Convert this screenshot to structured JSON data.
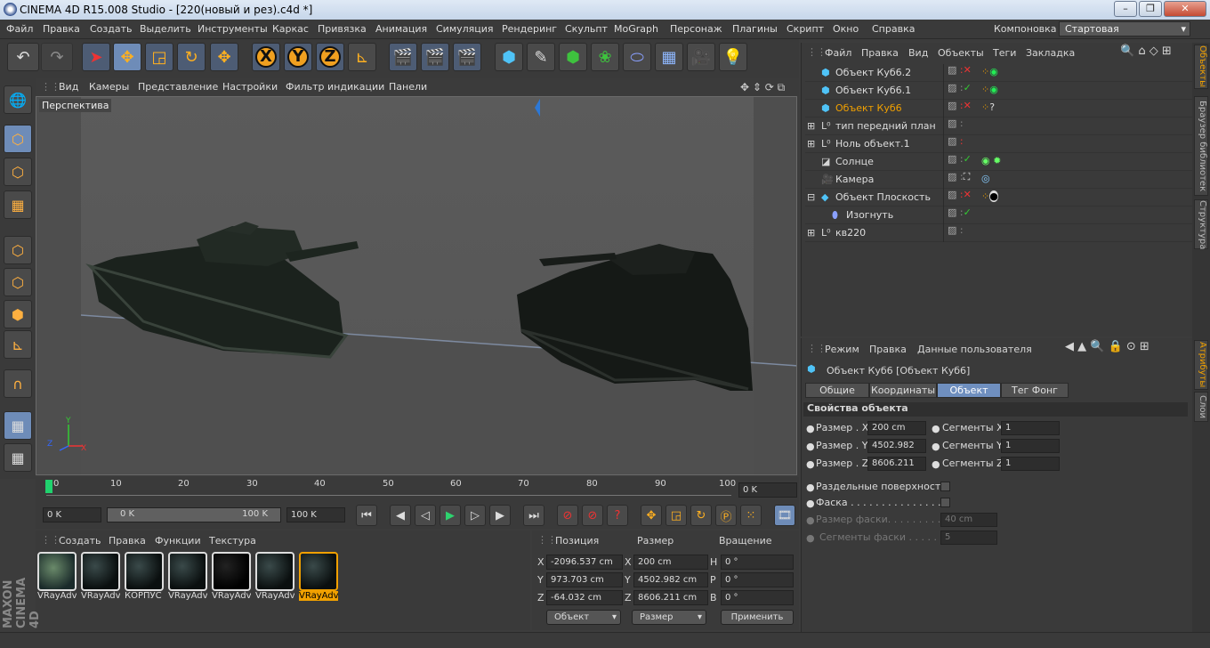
{
  "window": {
    "title": "CINEMA 4D R15.008 Studio - [220(новый  и рез).c4d *]"
  },
  "menu": [
    "Файл",
    "Правка",
    "Создать",
    "Выделить",
    "Инструменты",
    "Каркас",
    "Привязка",
    "Анимация",
    "Симуляция",
    "Рендеринг",
    "Скульпт",
    "MoGraph",
    "Персонаж",
    "Плагины",
    "Скрипт",
    "Окно",
    "Справка"
  ],
  "layout": {
    "label": "Компоновка",
    "value": "Стартовая"
  },
  "toolbar": {
    "x": "X",
    "y": "Y",
    "z": "Z"
  },
  "viewport": {
    "menu": [
      "Вид",
      "Камеры",
      "Представление",
      "Настройки",
      "Фильтр индикации",
      "Панели"
    ],
    "label": "Перспектива"
  },
  "timeline": {
    "ticks": [
      "0",
      "10",
      "20",
      "30",
      "40",
      "50",
      "60",
      "70",
      "80",
      "90",
      "100"
    ],
    "end_field": "0 K"
  },
  "playbar": {
    "start": "0 K",
    "range_start": "0 K",
    "range_end": "100 K",
    "end": "100 K"
  },
  "materials": {
    "menu": [
      "Создать",
      "Правка",
      "Функции",
      "Текстура"
    ],
    "items": [
      {
        "label": "VRayAdv"
      },
      {
        "label": "VRayAdv"
      },
      {
        "label": "КОРПУС"
      },
      {
        "label": "VRayAdv"
      },
      {
        "label": "VRayAdv"
      },
      {
        "label": "VRayAdv"
      },
      {
        "label": "VRayAdv"
      }
    ]
  },
  "coords": {
    "headers": {
      "position": "Позиция",
      "size": "Размер",
      "rotation": "Вращение"
    },
    "rows": [
      {
        "axis": "X",
        "pos": "-2096.537 cm",
        "saxis": "X",
        "size": "200 cm",
        "raxis": "H",
        "rot": "0 °"
      },
      {
        "axis": "Y",
        "pos": "973.703 cm",
        "saxis": "Y",
        "size": "4502.982 cm",
        "raxis": "P",
        "rot": "0 °"
      },
      {
        "axis": "Z",
        "pos": "-64.032 cm",
        "saxis": "Z",
        "size": "8606.211 cm",
        "raxis": "B",
        "rot": "0 °"
      }
    ],
    "mode": "Объект",
    "size_mode": "Размер",
    "apply": "Применить"
  },
  "objects": {
    "menu": [
      "Файл",
      "Правка",
      "Вид",
      "Объекты",
      "Теги",
      "Закладка"
    ],
    "items": [
      {
        "name": "Объект Куб6.2",
        "selected": false
      },
      {
        "name": "Объект Куб6.1",
        "selected": false
      },
      {
        "name": "Объект Куб6",
        "selected": true
      },
      {
        "name": "тип   передний  план",
        "selected": false
      },
      {
        "name": "Ноль объект.1",
        "selected": false
      },
      {
        "name": "Солнце",
        "selected": false
      },
      {
        "name": "Камера",
        "selected": false
      },
      {
        "name": "Объект Плоскость",
        "selected": false
      },
      {
        "name": "Изогнуть",
        "selected": false
      },
      {
        "name": "кв220",
        "selected": false
      }
    ]
  },
  "attributes": {
    "menu": [
      "Режим",
      "Правка",
      "Данные пользователя"
    ],
    "title": "Объект Куб6 [Объект Куб6]",
    "tabs": [
      "Общие",
      "Координаты",
      "Объект",
      "Тег Фонг"
    ],
    "selected_tab": "Объект",
    "section": "Свойства объекта",
    "size_x_label": "Размер . X",
    "size_x": "200 cm",
    "size_y_label": "Размер . Y",
    "size_y": "4502.982",
    "size_z_label": "Размер . Z",
    "size_z": "8606.211",
    "seg_x_label": "Сегменты X",
    "seg_x": "1",
    "seg_y_label": "Сегменты Y",
    "seg_y": "1",
    "seg_z_label": "Сегменты Z",
    "seg_z": "1",
    "separate_label": "Раздельные поверхности",
    "fillet_label": "Фаска . . . . . . . . . . . . . . . .",
    "fillet_size_label": "Размер фаски. . . . . . . . . . .",
    "fillet_size": "40 cm",
    "fillet_seg_label": "Сегменты фаски . . . . . . . .",
    "fillet_seg": "5"
  },
  "side_tabs": [
    "Объекты",
    "Браузер библиотек",
    "Структура",
    "Атрибуты",
    "Слои"
  ]
}
